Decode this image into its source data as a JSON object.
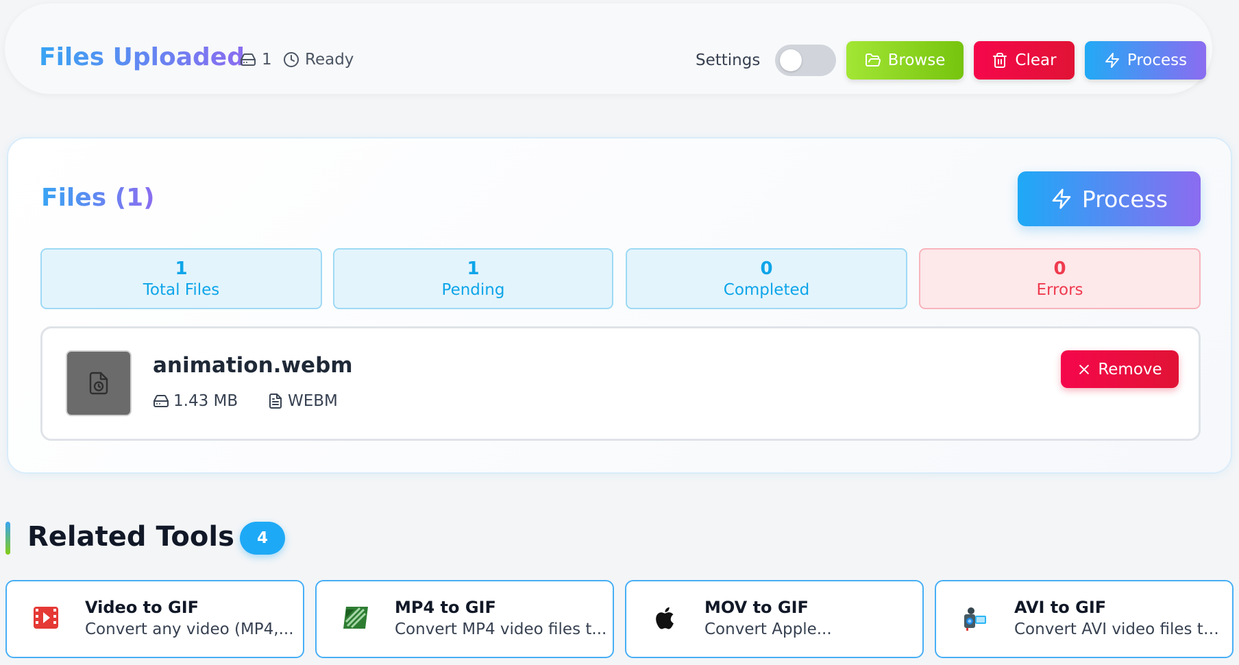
{
  "header": {
    "title": "Files Uploaded",
    "file_count": "1",
    "status": "Ready",
    "settings_label": "Settings",
    "settings_enabled": false,
    "buttons": {
      "browse": "Browse",
      "clear": "Clear",
      "process": "Process"
    }
  },
  "files_panel": {
    "title": "Files (1)",
    "process_label": "Process",
    "stats": [
      {
        "value": "1",
        "label": "Total Files"
      },
      {
        "value": "1",
        "label": "Pending"
      },
      {
        "value": "0",
        "label": "Completed"
      },
      {
        "value": "0",
        "label": "Errors"
      }
    ],
    "files": [
      {
        "name": "animation.webm",
        "size": "1.43 MB",
        "type": "WEBM",
        "remove_label": "Remove"
      }
    ]
  },
  "related": {
    "title": "Related Tools",
    "count": "4",
    "tools": [
      {
        "name": "Video to GIF",
        "description": "Convert any video (MP4,...",
        "icon": "film-icon"
      },
      {
        "name": "MP4 to GIF",
        "description": "Convert MP4 video files t...",
        "icon": "mp4-icon"
      },
      {
        "name": "MOV to GIF",
        "description": "Convert Apple...",
        "icon": "apple-icon"
      },
      {
        "name": "AVI to GIF",
        "description": "Convert AVI video files to...",
        "icon": "camcorder-icon"
      }
    ]
  },
  "colors": {
    "accent_blue": "#38a4f3",
    "accent_purple": "#8b6cf0",
    "browse_green": "#84cc16",
    "danger_red": "#e11335"
  }
}
